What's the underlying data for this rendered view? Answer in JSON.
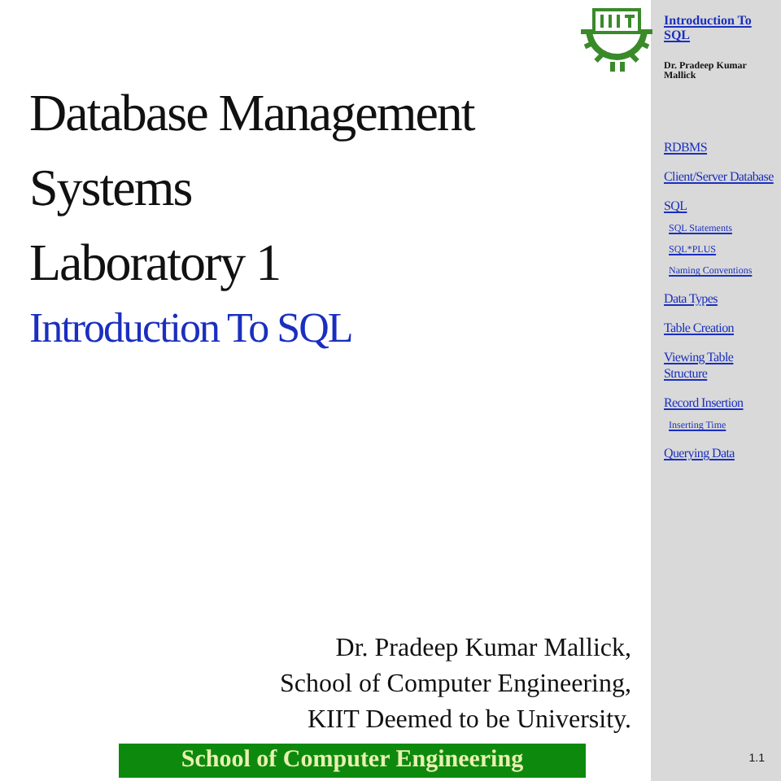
{
  "slide": {
    "title_lines": [
      "Database Management",
      "Systems",
      "Laboratory 1"
    ],
    "subtitle": "Introduction To SQL",
    "author_lines": [
      "Dr. Pradeep Kumar Mallick,",
      "School of Computer Engineering,",
      "KIIT Deemed to be University."
    ],
    "footer_banner": "School of Computer Engineering"
  },
  "sidebar": {
    "header_link": "Introduction To SQL",
    "author": "Dr. Pradeep Kumar Mallick",
    "nav_items": [
      {
        "label": "RDBMS"
      },
      {
        "label": "Client/Server Database"
      },
      {
        "label": "SQL",
        "children": [
          {
            "label": "SQL Statements"
          },
          {
            "label": "SQL*PLUS"
          },
          {
            "label": "Naming Conventions"
          }
        ]
      },
      {
        "label": "Data Types"
      },
      {
        "label": "Table Creation"
      },
      {
        "label": "Viewing Table Structure"
      },
      {
        "label": "Record Insertion",
        "children": [
          {
            "label": "Inserting Time"
          }
        ]
      },
      {
        "label": "Querying Data"
      }
    ],
    "page_number": "1.1"
  }
}
